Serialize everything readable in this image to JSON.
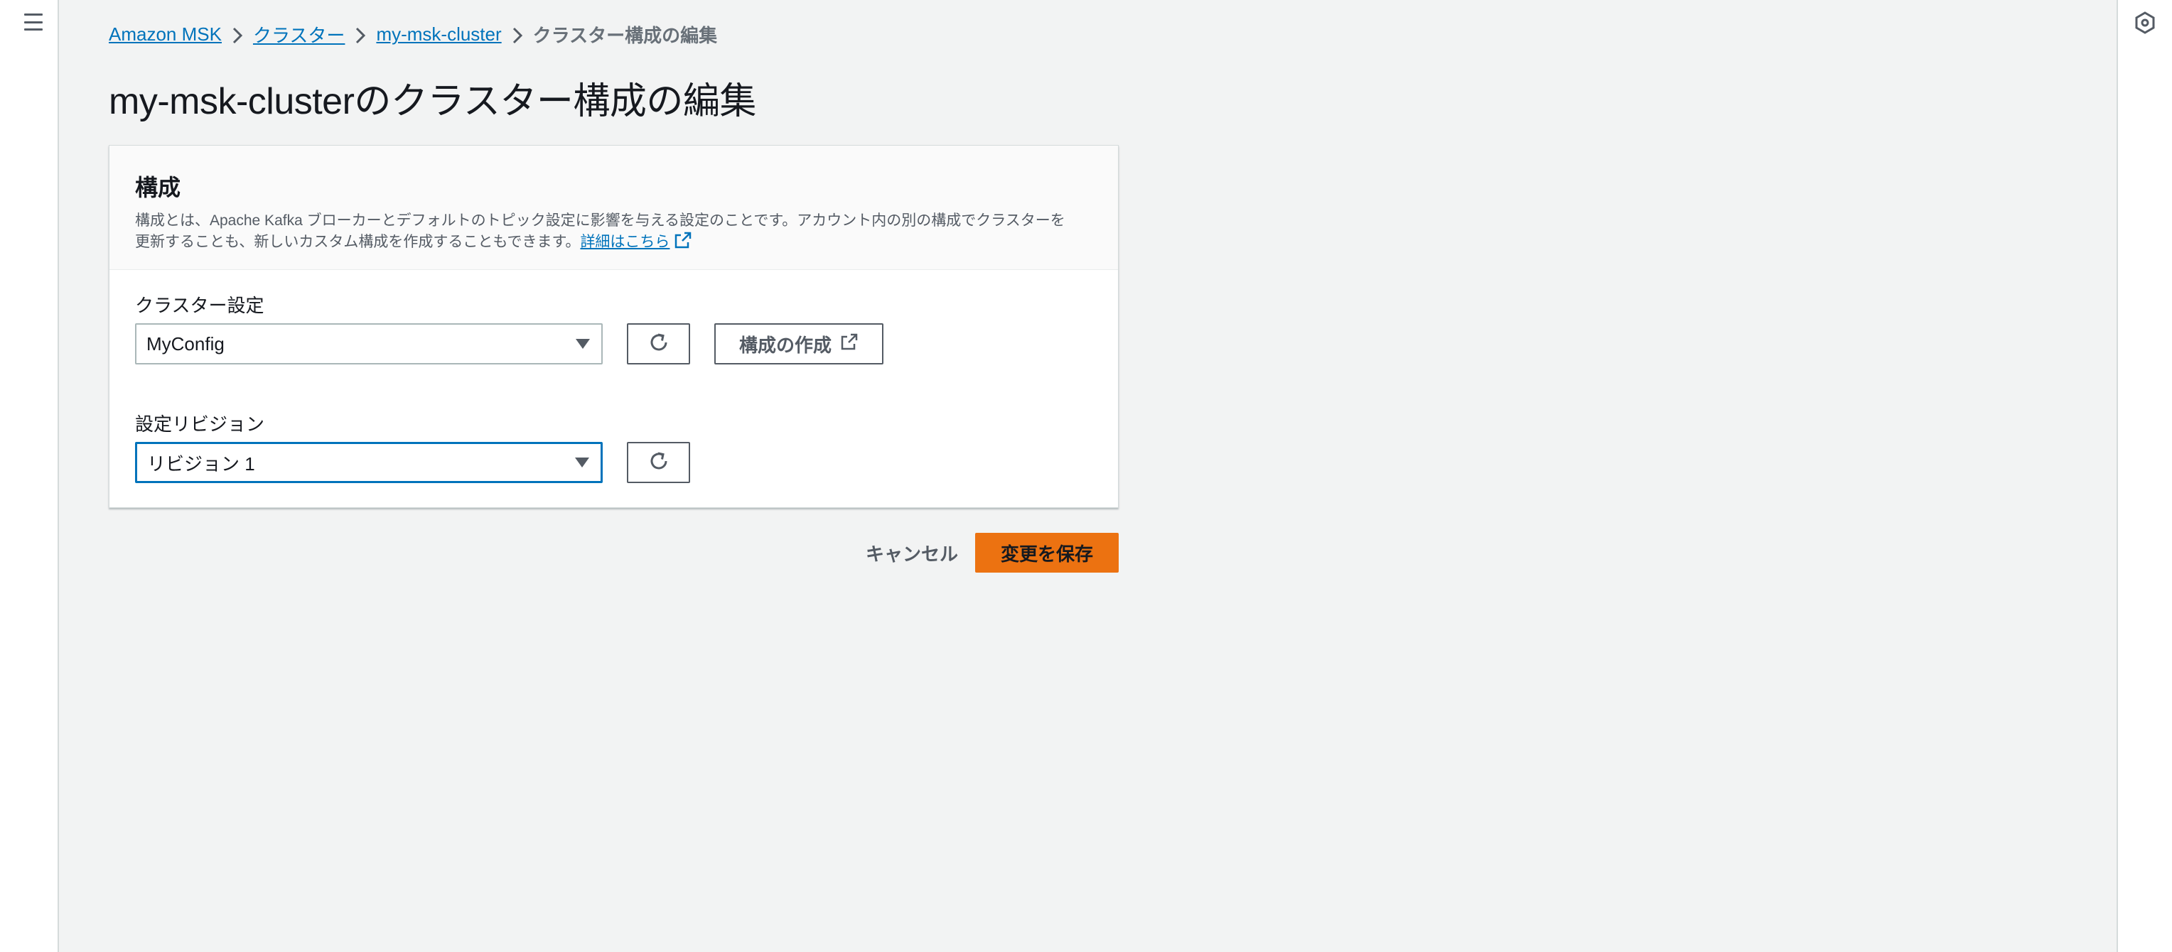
{
  "breadcrumb": {
    "items": [
      "Amazon MSK",
      "クラスター",
      "my-msk-cluster"
    ],
    "current": "クラスター構成の編集"
  },
  "page": {
    "title": "my-msk-clusterのクラスター構成の編集"
  },
  "panel": {
    "title": "構成",
    "description_line1": "構成とは、Apache Kafka ブローカーとデフォルトのトピック設定に影響を与える設定のことです。アカウント内の別の構成でクラスターを",
    "description_line2": "更新することも、新しいカスタム構成を作成することもできます。",
    "learn_more": "詳細はこちら"
  },
  "cluster_config": {
    "label": "クラスター設定",
    "value": "MyConfig",
    "create_label": "構成の作成"
  },
  "revision": {
    "label": "設定リビジョン",
    "value": "リビジョン 1"
  },
  "actions": {
    "cancel": "キャンセル",
    "save": "変更を保存"
  },
  "colors": {
    "primary": "#ec7211",
    "link": "#0073bb",
    "focus": "#0073bb"
  },
  "icons": {
    "menu": "hamburger-menu-icon",
    "tools": "info-hexagon-icon",
    "refresh": "refresh-icon",
    "external": "external-link-icon",
    "chevron": "chevron-right-icon"
  }
}
